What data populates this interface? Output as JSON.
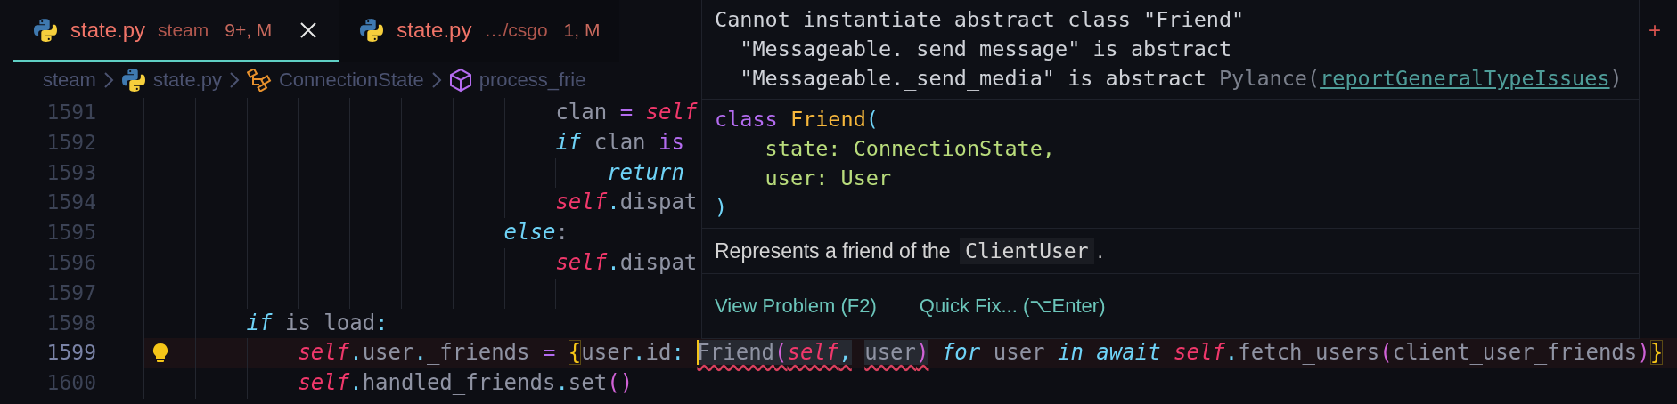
{
  "tabs": [
    {
      "name": "state.py",
      "description": "steam",
      "badge": "9+, M",
      "selected": true,
      "closable": true
    },
    {
      "name": "state.py",
      "description": "…/csgo",
      "badge": "1, M",
      "selected": false,
      "closable": false
    }
  ],
  "breadcrumbs": [
    {
      "label": "steam",
      "kind": "folder"
    },
    {
      "label": "state.py",
      "kind": "python"
    },
    {
      "label": "ConnectionState",
      "kind": "class"
    },
    {
      "label": "process_frie",
      "kind": "method"
    }
  ],
  "editor": {
    "lines": [
      {
        "number": "1591",
        "active": false,
        "lightbulb": false,
        "tokens": [
          {
            "text": "                                clan",
            "kind": "plain"
          },
          {
            "text": " =",
            "kind": "op"
          },
          {
            "text": " self",
            "kind": "self"
          }
        ]
      },
      {
        "number": "1592",
        "active": false,
        "lightbulb": false,
        "tokens": [
          {
            "text": "                                if",
            "kind": "kw"
          },
          {
            "text": " clan",
            "kind": "plain"
          },
          {
            "text": " is",
            "kind": "op"
          }
        ]
      },
      {
        "number": "1593",
        "active": false,
        "lightbulb": false,
        "tokens": [
          {
            "text": "                                    return",
            "kind": "kw"
          }
        ]
      },
      {
        "number": "1594",
        "active": false,
        "lightbulb": false,
        "tokens": [
          {
            "text": "                                self",
            "kind": "self"
          },
          {
            "text": ".",
            "kind": "punct"
          },
          {
            "text": "dispat",
            "kind": "plain"
          }
        ]
      },
      {
        "number": "1595",
        "active": false,
        "lightbulb": false,
        "tokens": [
          {
            "text": "                            else",
            "kind": "kw"
          },
          {
            "text": ":",
            "kind": "plain"
          }
        ]
      },
      {
        "number": "1596",
        "active": false,
        "lightbulb": false,
        "tokens": [
          {
            "text": "                                self",
            "kind": "self"
          },
          {
            "text": ".",
            "kind": "punct"
          },
          {
            "text": "dispat",
            "kind": "plain"
          }
        ]
      },
      {
        "number": "1597",
        "active": false,
        "lightbulb": false
      },
      {
        "number": "1598",
        "active": false,
        "lightbulb": false,
        "tokens": [
          {
            "text": "        if",
            "kind": "kw"
          },
          {
            "text": " is_load",
            "kind": "plain"
          },
          {
            "text": ":",
            "kind": "punct"
          }
        ]
      },
      {
        "number": "1599",
        "active": true,
        "lightbulb": true,
        "tokens": [
          {
            "text": "            self",
            "kind": "self"
          },
          {
            "text": ".",
            "kind": "punct"
          },
          {
            "text": "user",
            "kind": "plain"
          },
          {
            "text": ".",
            "kind": "punct"
          },
          {
            "text": "_friends",
            "kind": "plain"
          },
          {
            "text": " =",
            "kind": "op"
          },
          {
            "text": " {",
            "kind": "brace"
          },
          {
            "text": "user",
            "kind": "plain"
          },
          {
            "text": ".",
            "kind": "punct"
          },
          {
            "text": "id",
            "kind": "plain"
          },
          {
            "text": ":",
            "kind": "punct"
          },
          {
            "text": " Friend",
            "kind": "plain",
            "squiggle": true,
            "caret": true
          },
          {
            "text": "(",
            "kind": "paren",
            "squiggle": true
          },
          {
            "text": "self",
            "kind": "self",
            "squiggle": true
          },
          {
            "text": ",",
            "kind": "punct",
            "squiggle": true
          },
          {
            "text": " user",
            "kind": "plain",
            "squiggle": true
          },
          {
            "text": ")",
            "kind": "paren",
            "squiggle": true
          },
          {
            "text": " for",
            "kind": "kw"
          },
          {
            "text": " user",
            "kind": "plain"
          },
          {
            "text": " in",
            "kind": "kw"
          },
          {
            "text": " await",
            "kind": "kw"
          },
          {
            "text": " self",
            "kind": "self"
          },
          {
            "text": ".",
            "kind": "punct"
          },
          {
            "text": "fetch_users",
            "kind": "plain"
          },
          {
            "text": "(",
            "kind": "paren"
          },
          {
            "text": "client_user_friends",
            "kind": "plain"
          },
          {
            "text": ")",
            "kind": "paren"
          },
          {
            "text": "}",
            "kind": "brace"
          }
        ]
      },
      {
        "number": "1600",
        "active": false,
        "lightbulb": false,
        "tokens": [
          {
            "text": "            self",
            "kind": "self"
          },
          {
            "text": ".",
            "kind": "punct"
          },
          {
            "text": "handled_friends",
            "kind": "plain"
          },
          {
            "text": ".",
            "kind": "punct"
          },
          {
            "text": "set",
            "kind": "plain"
          },
          {
            "text": "(",
            "kind": "paren"
          },
          {
            "text": ")",
            "kind": "paren"
          }
        ]
      }
    ]
  },
  "hover": {
    "message": [
      "Cannot instantiate abstract class \"Friend\"",
      "  \"Messageable._send_message\" is abstract",
      "  \"Messageable._send_media\" is abstract"
    ],
    "source": "Pylance(",
    "rule": "reportGeneralTypeIssues",
    "source_end": ")",
    "signature": [
      [
        {
          "text": "class",
          "kind": "op"
        },
        {
          "text": " Friend",
          "kind": "cls"
        },
        {
          "text": "(",
          "kind": "punct"
        }
      ],
      [
        {
          "text": "    state: ConnectionState,",
          "kind": "param"
        }
      ],
      [
        {
          "text": "    user: User",
          "kind": "param"
        }
      ],
      [
        {
          "text": ")",
          "kind": "punct"
        }
      ]
    ],
    "doc": {
      "text": "Represents a friend of the",
      "code": "ClientUser",
      "end": "."
    },
    "actions": [
      "View Problem (F2)",
      "Quick Fix... (⌥Enter)"
    ]
  },
  "gutter_marker": "+"
}
